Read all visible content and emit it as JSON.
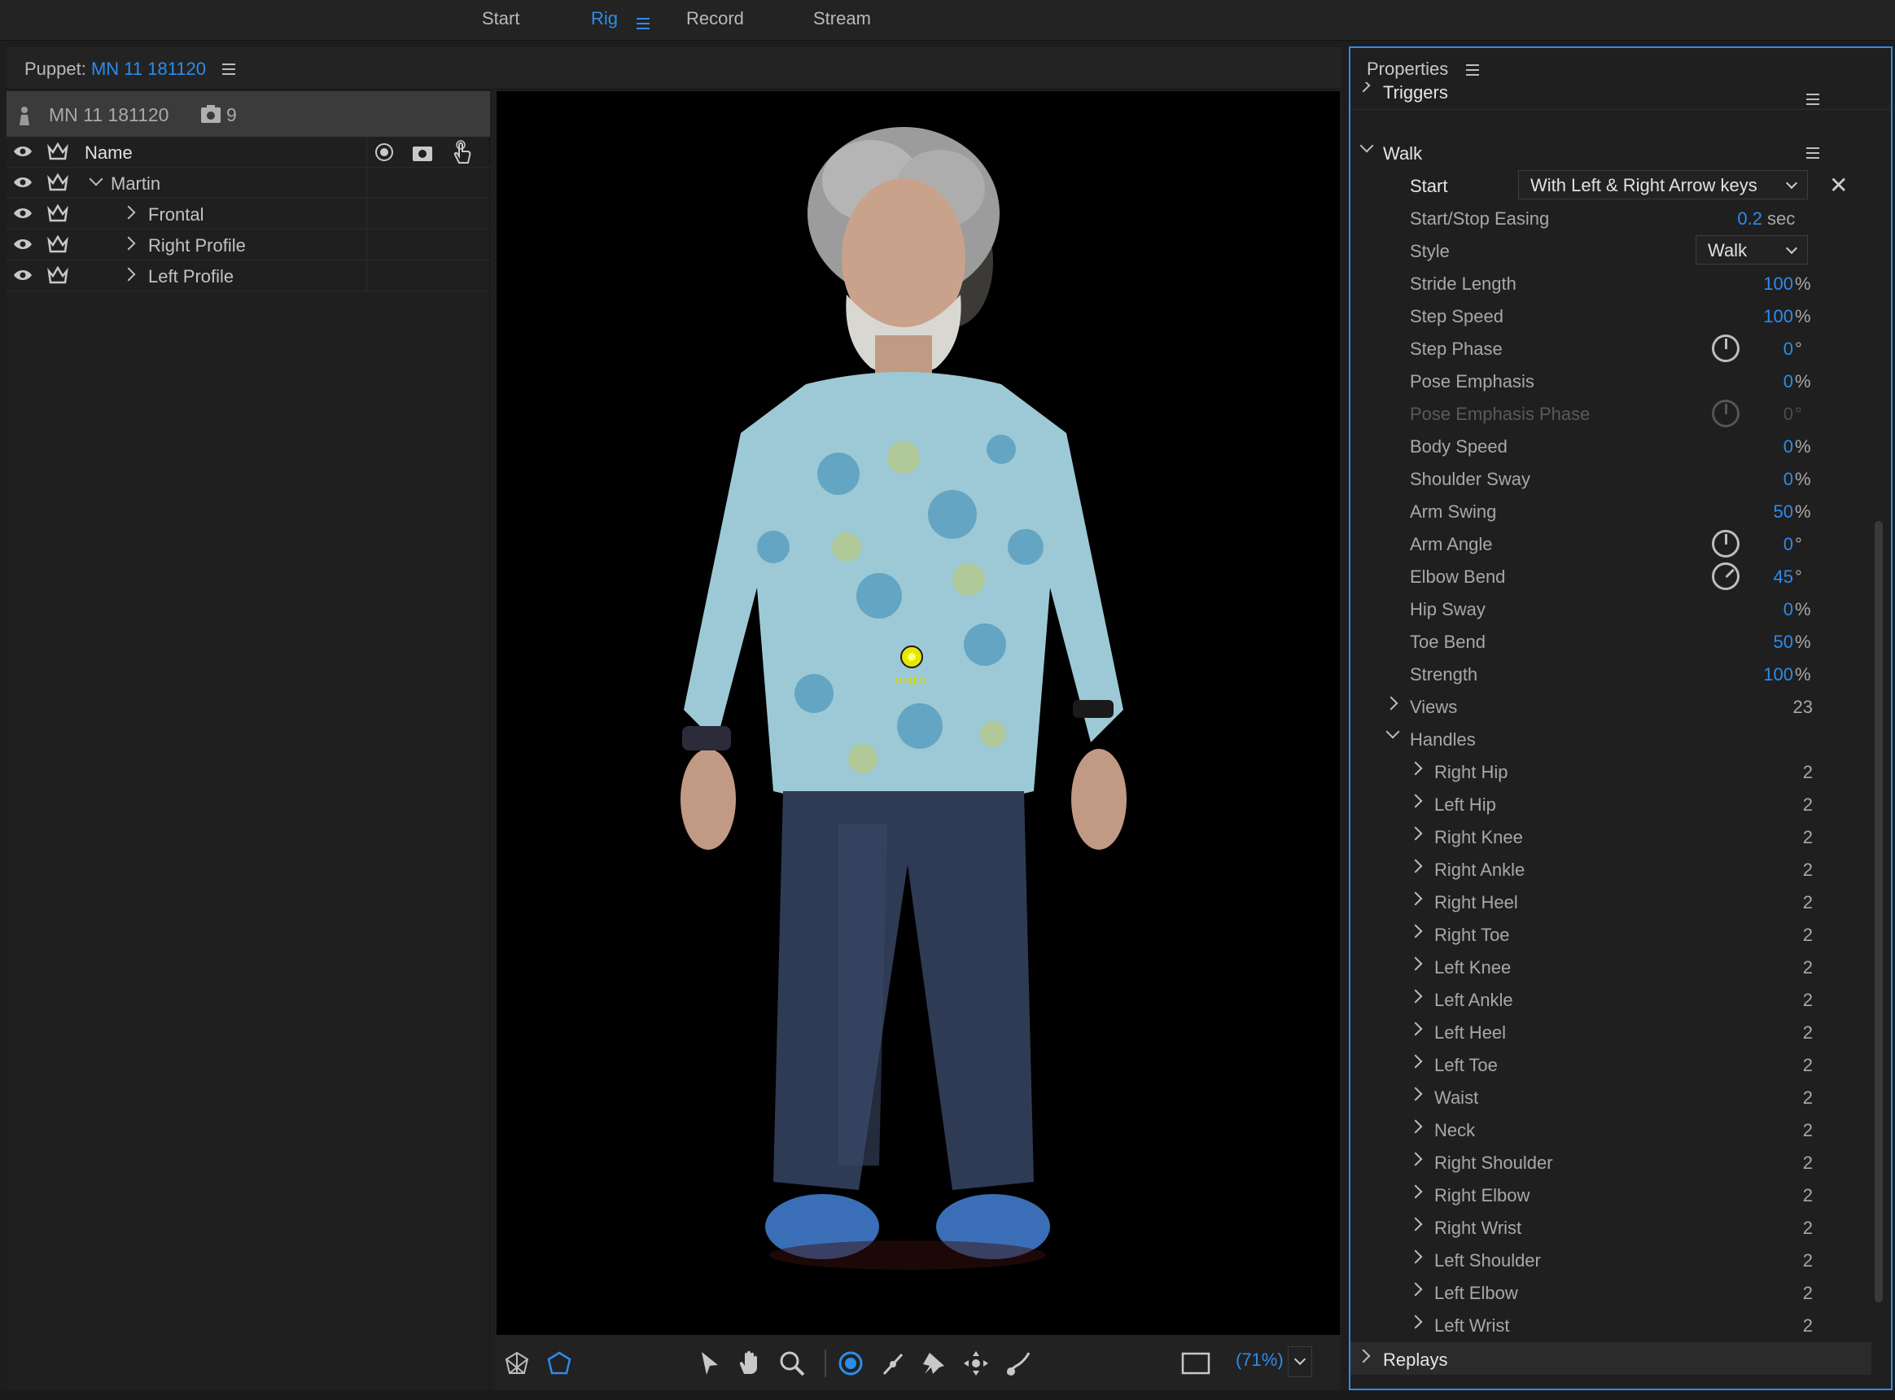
{
  "workspace_tabs": {
    "start": "Start",
    "rig": "Rig",
    "record": "Record",
    "stream": "Stream"
  },
  "puppet_panel": {
    "title_prefix": "Puppet:",
    "puppet_name": "MN 11 181120"
  },
  "layers": {
    "puppet_name": "MN 11 181120",
    "count": "9",
    "column_name": "Name",
    "items": [
      {
        "label": "Martin"
      },
      {
        "label": "Frontal"
      },
      {
        "label": "Right Profile"
      },
      {
        "label": "Left Profile"
      }
    ]
  },
  "canvas": {
    "origin_label": "origin",
    "zoom": "(71%)"
  },
  "properties": {
    "title": "Properties",
    "triggers": "Triggers",
    "walk": "Walk",
    "start_label": "Start",
    "start_value": "With Left & Right Arrow keys",
    "easing": {
      "label": "Start/Stop Easing",
      "value": "0.2",
      "unit": "sec"
    },
    "style": {
      "label": "Style",
      "value": "Walk"
    },
    "params": [
      {
        "label": "Stride Length",
        "value": "100",
        "unit": "%"
      },
      {
        "label": "Step Speed",
        "value": "100",
        "unit": "%"
      },
      {
        "label": "Step Phase",
        "value": "0",
        "unit": "°"
      },
      {
        "label": "Pose Emphasis",
        "value": "0",
        "unit": "%"
      },
      {
        "label": "Pose Emphasis Phase",
        "value": "0",
        "unit": "°"
      },
      {
        "label": "Body Speed",
        "value": "0",
        "unit": "%"
      },
      {
        "label": "Shoulder Sway",
        "value": "0",
        "unit": "%"
      },
      {
        "label": "Arm Swing",
        "value": "50",
        "unit": "%"
      },
      {
        "label": "Arm Angle",
        "value": "0",
        "unit": "°"
      },
      {
        "label": "Elbow Bend",
        "value": "45",
        "unit": "°"
      },
      {
        "label": "Hip Sway",
        "value": "0",
        "unit": "%"
      },
      {
        "label": "Toe Bend",
        "value": "50",
        "unit": "%"
      },
      {
        "label": "Strength",
        "value": "100",
        "unit": "%"
      }
    ],
    "views": {
      "label": "Views",
      "count": "23"
    },
    "handles_label": "Handles",
    "handles": [
      {
        "label": "Right Hip",
        "count": "2"
      },
      {
        "label": "Left Hip",
        "count": "2"
      },
      {
        "label": "Right Knee",
        "count": "2"
      },
      {
        "label": "Right Ankle",
        "count": "2"
      },
      {
        "label": "Right Heel",
        "count": "2"
      },
      {
        "label": "Right Toe",
        "count": "2"
      },
      {
        "label": "Left Knee",
        "count": "2"
      },
      {
        "label": "Left Ankle",
        "count": "2"
      },
      {
        "label": "Left Heel",
        "count": "2"
      },
      {
        "label": "Left Toe",
        "count": "2"
      },
      {
        "label": "Waist",
        "count": "2"
      },
      {
        "label": "Neck",
        "count": "2"
      },
      {
        "label": "Right Shoulder",
        "count": "2"
      },
      {
        "label": "Right Elbow",
        "count": "2"
      },
      {
        "label": "Right Wrist",
        "count": "2"
      },
      {
        "label": "Left Shoulder",
        "count": "2"
      },
      {
        "label": "Left Elbow",
        "count": "2"
      },
      {
        "label": "Left Wrist",
        "count": "2"
      }
    ],
    "replays": "Replays"
  },
  "colors": {
    "accent": "#2d8ceb",
    "panel_bg": "#1f1f1f",
    "canvas_bg": "#000000"
  }
}
